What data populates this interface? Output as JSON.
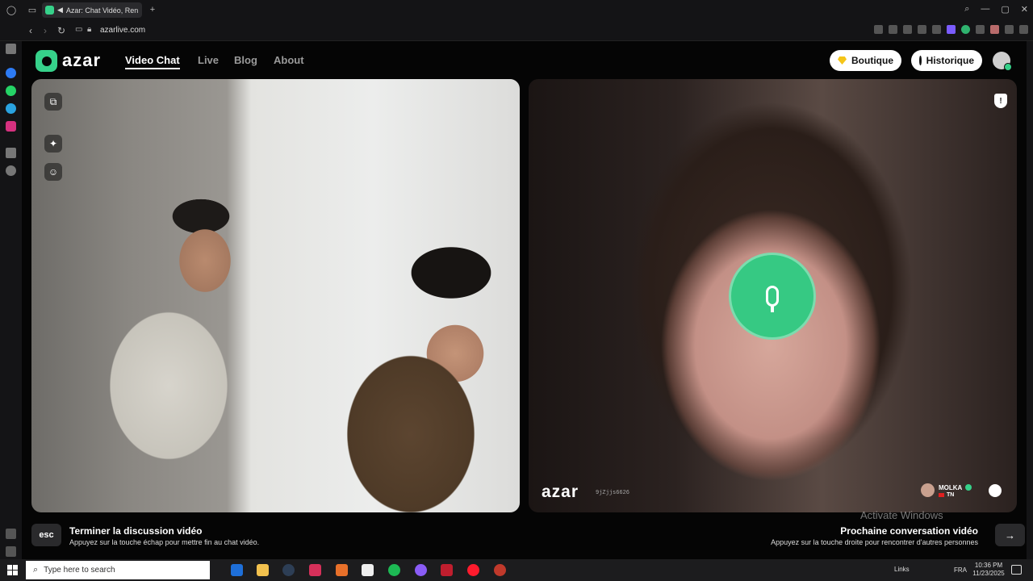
{
  "browser": {
    "tab_title": "Azar: Chat Vidéo, Ren",
    "url": "azarlive.com"
  },
  "site": {
    "logo": "azar",
    "nav": [
      {
        "label": "Video Chat",
        "active": true
      },
      {
        "label": "Live"
      },
      {
        "label": "Blog"
      },
      {
        "label": "About"
      }
    ],
    "boutique_label": "Boutique",
    "historique_label": "Historique",
    "accent_color": "#36d18a"
  },
  "remote": {
    "watermark": "azar",
    "watermark_id": "9jZjjs6626",
    "peer_name": "MOLKA",
    "peer_country": "TN"
  },
  "hints": {
    "esc_key": "esc",
    "end_title": "Terminer la discussion vidéo",
    "end_desc": "Appuyez sur la touche échap pour mettre fin au chat vidéo.",
    "next_title": "Prochaine conversation vidéo",
    "next_desc": "Appuyez sur la touche droite pour rencontrer d'autres personnes",
    "next_key": "→"
  },
  "os": {
    "activate_windows": "Activate Windows",
    "search_placeholder": "Type here to search",
    "tray_links": "Links",
    "lang": "FRA",
    "time": "10:36 PM",
    "date": "11/23/2025"
  }
}
